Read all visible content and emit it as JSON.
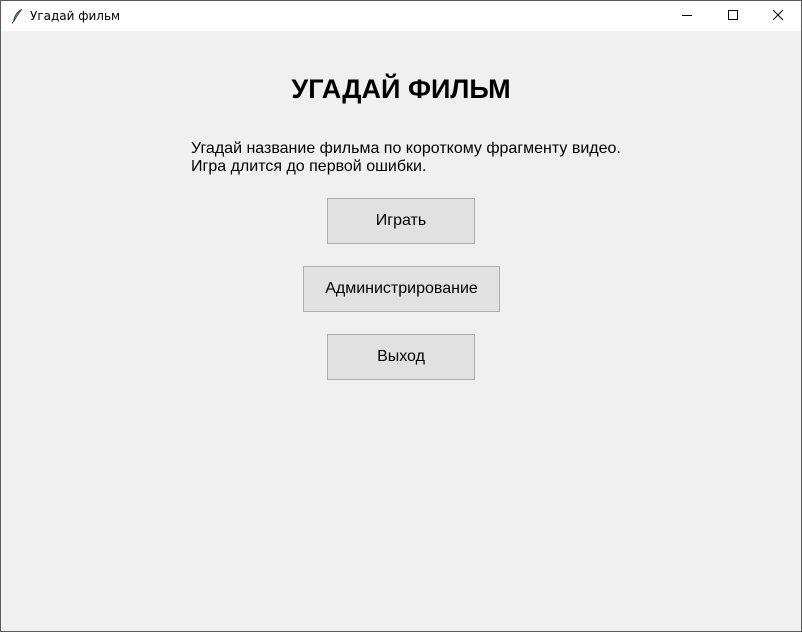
{
  "window": {
    "title": "Угадай фильм",
    "app_icon": "feather-icon",
    "controls": {
      "minimize_icon": "minimize-icon",
      "maximize_icon": "maximize-icon",
      "close_icon": "close-icon"
    }
  },
  "main": {
    "heading": "УГАДАЙ ФИЛЬМ",
    "description_line1": "Угадай название фильма по короткому фрагменту видео.",
    "description_line2": "Игра длится до первой ошибки.",
    "buttons": {
      "play": "Играть",
      "admin": "Администрирование",
      "exit": "Выход"
    }
  },
  "colors": {
    "background": "#f0f0f0",
    "button_face": "#e1e1e1",
    "button_border": "#adadad"
  }
}
